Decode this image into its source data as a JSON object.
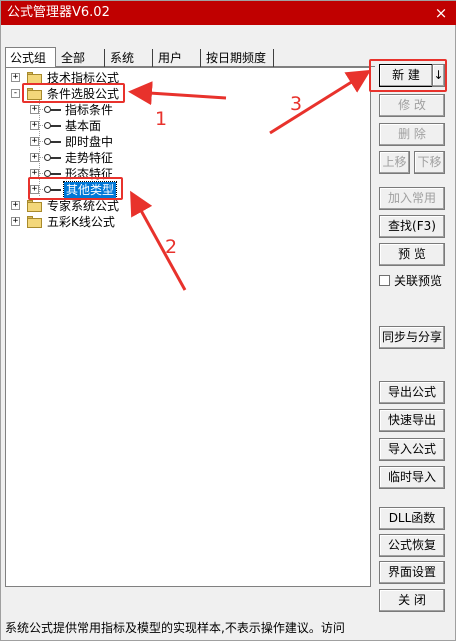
{
  "window": {
    "title": "公式管理器V6.02",
    "close_glyph": "×"
  },
  "tabs": [
    {
      "label": "公式组",
      "active": true
    },
    {
      "label": "全部"
    },
    {
      "label": "系统"
    },
    {
      "label": "用户"
    },
    {
      "label": "按日期频度"
    }
  ],
  "tree": {
    "nodes": [
      {
        "label": "技术指标公式",
        "icon": "folder-icon",
        "expander": "+",
        "depth": 0
      },
      {
        "label": "条件选股公式",
        "icon": "folder-open-icon",
        "expander": "-",
        "depth": 0
      },
      {
        "label": "指标条件",
        "icon": "key-icon",
        "expander": "+",
        "depth": 1
      },
      {
        "label": "基本面",
        "icon": "key-icon",
        "expander": "+",
        "depth": 1
      },
      {
        "label": "即时盘中",
        "icon": "key-icon",
        "expander": "+",
        "depth": 1
      },
      {
        "label": "走势特征",
        "icon": "key-icon",
        "expander": "+",
        "depth": 1
      },
      {
        "label": "形态特征",
        "icon": "key-icon",
        "expander": "+",
        "depth": 1
      },
      {
        "label": "其他类型",
        "icon": "key-icon",
        "expander": "+",
        "depth": 1,
        "selected": true
      },
      {
        "label": "专家系统公式",
        "icon": "folder-icon",
        "expander": "+",
        "depth": 0
      },
      {
        "label": "五彩K线公式",
        "icon": "folder-icon",
        "expander": "+",
        "depth": 0
      }
    ]
  },
  "buttons": {
    "new": "新 建",
    "new_menu_glyph": "↓",
    "modify": "修 改",
    "delete": "删 除",
    "move_up": "上移",
    "move_down": "下移",
    "add_common": "加入常用",
    "find": "查找(F3)",
    "preview": "预 览",
    "link_preview": "关联预览",
    "sync_share": "同步与分享",
    "export_formula": "导出公式",
    "quick_export": "快速导出",
    "import_formula": "导入公式",
    "temp_import": "临时导入",
    "dll_function": "DLL函数",
    "formula_restore": "公式恢复",
    "ui_settings": "界面设置",
    "close": "关 闭"
  },
  "status": {
    "text": "系统公式提供常用指标及模型的实现样本,不表示操作建议。访问"
  },
  "annotations": {
    "n1": "1",
    "n2": "2",
    "n3": "3",
    "color": "#e8322c"
  }
}
